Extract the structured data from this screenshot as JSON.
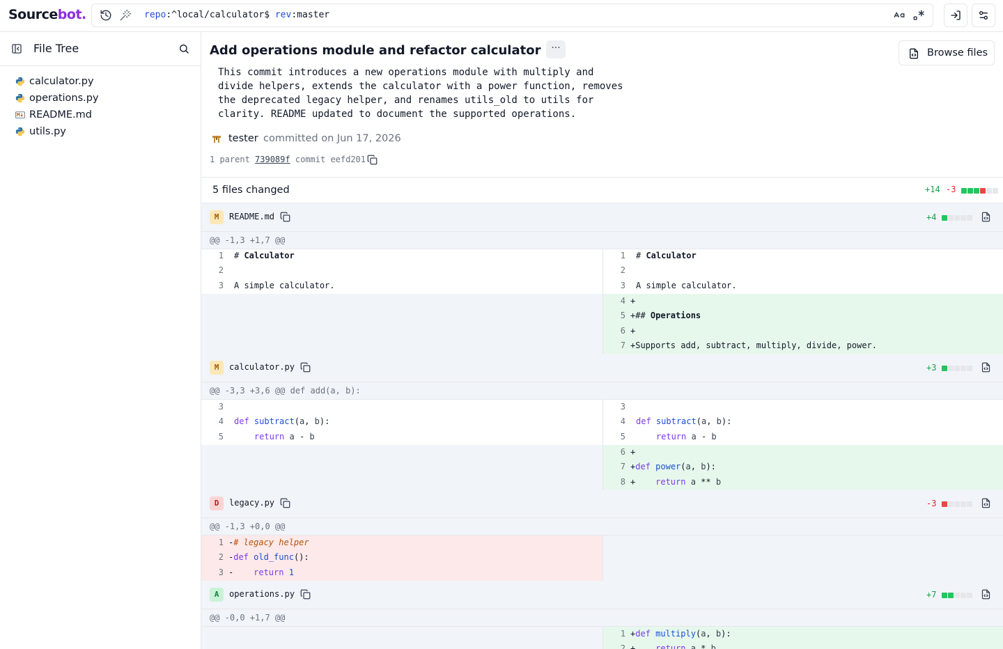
{
  "app": {
    "logo_main": "Source",
    "logo_accent": "bot."
  },
  "search": {
    "repo_key": "repo",
    "repo_value": ":^local/calculator$ ",
    "rev_key": "rev",
    "rev_value": ":master"
  },
  "sidebar": {
    "title": "File Tree",
    "files": [
      {
        "name": "calculator.py",
        "icon": "python-file-icon"
      },
      {
        "name": "operations.py",
        "icon": "python-file-icon"
      },
      {
        "name": "README.md",
        "icon": "markdown-file-icon"
      },
      {
        "name": "utils.py",
        "icon": "python-file-icon"
      }
    ]
  },
  "commit": {
    "title": "Add operations module and refactor calculator",
    "more_label": "···",
    "browse_label": "Browse files",
    "body": "This commit introduces a new operations module with multiply and\ndivide helpers, extends the calculator with a power function, removes\nthe deprecated legacy helper, and renames utils_old to utils for\nclarity. README updated to document the supported operations.",
    "author": "tester",
    "committed_on": "committed on Jun 17, 2026",
    "parent_label": "1 parent",
    "parent_hash": "739089f",
    "commit_label": "commit",
    "commit_hash": "eefd201"
  },
  "summary": {
    "files_changed": "5 files changed",
    "additions": "+14",
    "deletions": "-3"
  },
  "files": [
    {
      "status": "M",
      "name": "README.md",
      "stat": "+4",
      "hunk": "@@ -1,3 +1,7 @@"
    },
    {
      "status": "M",
      "name": "calculator.py",
      "stat": "+3",
      "hunk": "@@ -3,3 +3,6 @@ def add(a, b):"
    },
    {
      "status": "D",
      "name": "legacy.py",
      "stat": "-3",
      "hunk": "@@ -1,3 +0,0 @@"
    },
    {
      "status": "A",
      "name": "operations.py",
      "stat": "+7",
      "hunk": "@@ -0,0 +1,7 @@"
    }
  ],
  "colors": {
    "accent": "#8b2fe0",
    "add": "#16a34a",
    "del": "#dc2626",
    "add_bg": "#e6f8ec",
    "del_bg": "#fde9e9"
  }
}
